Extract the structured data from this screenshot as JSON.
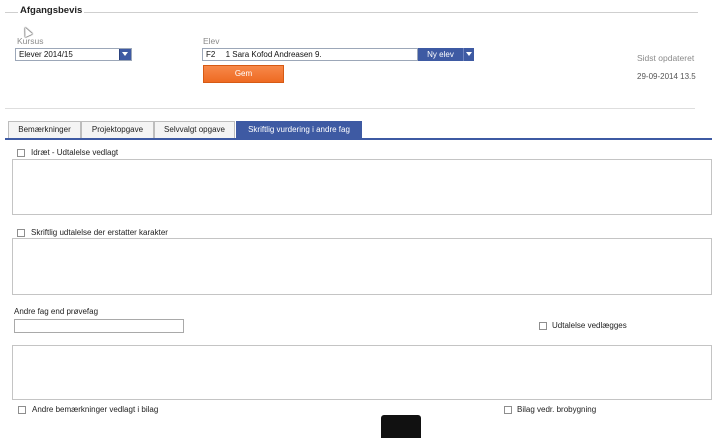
{
  "section": {
    "title": "Afgangsbevis"
  },
  "kursus": {
    "label": "Kursus",
    "selected": "Elever 2014/15"
  },
  "elev": {
    "label": "Elev",
    "class": "F2",
    "selected": "1 Sara Kofod Andreasen 9.",
    "new_button": "Ny elev"
  },
  "save_button": "Gem",
  "last_updated": {
    "label": "Sidst opdateret",
    "value": "29-09-2014 13.5"
  },
  "tabs": [
    {
      "label": "Bemærkninger"
    },
    {
      "label": "Projektopgave"
    },
    {
      "label": "Selvvalgt opgave"
    },
    {
      "label": "Skriftlig vurdering i andre fag",
      "active": true
    }
  ],
  "form": {
    "idraet_checkbox": "Idræt - Udtalelse vedlagt",
    "skriftlig_checkbox": "Skriftlig udtalelse der erstatter karakter",
    "andre_fag_label": "Andre fag end prøvefag",
    "andre_fag_value": "",
    "udtalelse_checkbox": "Udtalelse vedlægges",
    "andre_bemaerkninger_checkbox": "Andre bemærkninger vedlagt i bilag",
    "bilag_checkbox": "Bilag vedr. brobygning"
  },
  "colors": {
    "accent": "#3e5aa3",
    "save": "#ee6a22"
  }
}
